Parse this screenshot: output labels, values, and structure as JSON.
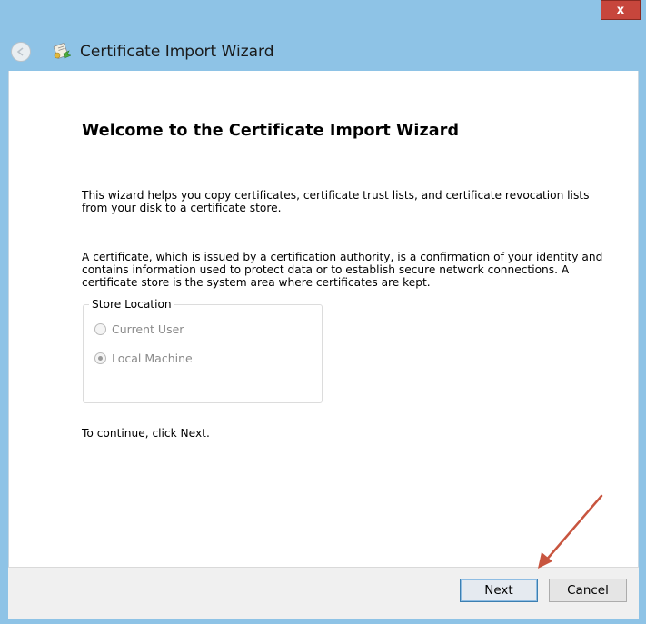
{
  "window": {
    "title": "Certificate Import Wizard",
    "close_label": "x"
  },
  "content": {
    "heading": "Welcome to the Certificate Import Wizard",
    "paragraph1": "This wizard helps you copy certificates, certificate trust lists, and certificate revocation lists from your disk to a certificate store.",
    "paragraph2": "A certificate, which is issued by a certification authority, is a confirmation of your identity and contains information used to protect data or to establish secure network connections. A certificate store is the system area where certificates are kept.",
    "store_location": {
      "legend": "Store Location",
      "options": [
        {
          "label": "Current User",
          "checked": false,
          "enabled": false
        },
        {
          "label": "Local Machine",
          "checked": true,
          "enabled": false
        }
      ]
    },
    "continue_text": "To continue, click Next."
  },
  "footer": {
    "next_label": "Next",
    "cancel_label": "Cancel"
  },
  "colors": {
    "frame": "#8ec3e6",
    "close": "#c7463c",
    "annotation_arrow": "#c8553f"
  }
}
